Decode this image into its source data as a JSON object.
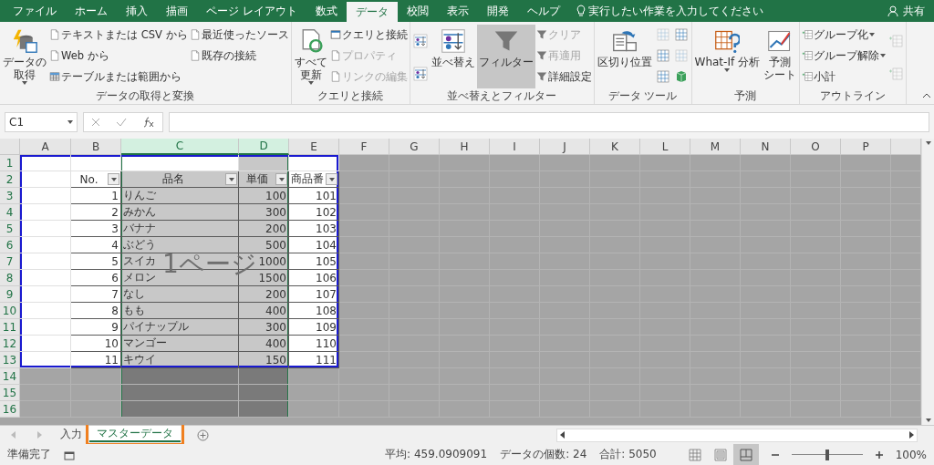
{
  "ribbon_tabs": [
    {
      "label": "ファイル",
      "selected": false
    },
    {
      "label": "ホーム",
      "selected": false
    },
    {
      "label": "挿入",
      "selected": false
    },
    {
      "label": "描画",
      "selected": false
    },
    {
      "label": "ページ レイアウト",
      "selected": false
    },
    {
      "label": "数式",
      "selected": false
    },
    {
      "label": "データ",
      "selected": true
    },
    {
      "label": "校閲",
      "selected": false
    },
    {
      "label": "表示",
      "selected": false
    },
    {
      "label": "開発",
      "selected": false
    },
    {
      "label": "ヘルプ",
      "selected": false
    }
  ],
  "tell_me": "実行したい作業を入力してください",
  "share": "共有",
  "ribbon_groups": [
    {
      "label": "データの取得と変換",
      "columns": [
        [
          {
            "kind": "large",
            "lines": [
              "データの",
              "取得"
            ],
            "dropdown": true,
            "disabled": false,
            "pressed": false
          }
        ],
        [
          {
            "kind": "small",
            "label": "テキストまたは CSV から",
            "disabled": false
          },
          {
            "kind": "small",
            "label": "Web から",
            "disabled": false
          },
          {
            "kind": "small",
            "label": "テーブルまたは範囲から",
            "disabled": false
          }
        ],
        [
          {
            "kind": "small",
            "label": "最近使ったソース",
            "disabled": false
          },
          {
            "kind": "small",
            "label": "既存の接続",
            "disabled": false
          }
        ]
      ]
    },
    {
      "label": "クエリと接続",
      "columns": [
        [
          {
            "kind": "large",
            "lines": [
              "すべて",
              "更新"
            ],
            "dropdown": true,
            "disabled": false,
            "pressed": false
          }
        ],
        [
          {
            "kind": "small",
            "label": "クエリと接続",
            "disabled": false
          },
          {
            "kind": "small",
            "label": "プロパティ",
            "disabled": true
          },
          {
            "kind": "small",
            "label": "リンクの編集",
            "disabled": true
          }
        ]
      ]
    },
    {
      "label": "並べ替えとフィルター",
      "columns": [
        [
          {
            "kind": "icon",
            "disabled": false
          },
          {
            "kind": "icon",
            "disabled": false
          }
        ],
        [
          {
            "kind": "large",
            "lines": [
              "並べ替え"
            ],
            "dropdown": false,
            "disabled": false,
            "pressed": false
          }
        ],
        [
          {
            "kind": "large",
            "lines": [
              "フィルター"
            ],
            "dropdown": false,
            "disabled": false,
            "pressed": true
          }
        ],
        [
          {
            "kind": "small",
            "label": "クリア",
            "disabled": true
          },
          {
            "kind": "small",
            "label": "再適用",
            "disabled": true
          },
          {
            "kind": "small",
            "label": "詳細設定",
            "disabled": false
          }
        ]
      ]
    },
    {
      "label": "データ ツール",
      "columns": [
        [
          {
            "kind": "large",
            "lines": [
              "区切り位置"
            ],
            "dropdown": false,
            "disabled": false,
            "pressed": false
          }
        ],
        [
          {
            "kind": "icon",
            "disabled": true
          },
          {
            "kind": "icon",
            "disabled": false
          },
          {
            "kind": "icon",
            "disabled": false
          }
        ],
        [
          {
            "kind": "icon",
            "disabled": false
          },
          {
            "kind": "icon",
            "disabled": true
          },
          {
            "kind": "icon",
            "disabled": false
          }
        ]
      ]
    },
    {
      "label": "予測",
      "columns": [
        [
          {
            "kind": "large",
            "lines": [
              "What-If 分析"
            ],
            "dropdown": true,
            "disabled": false,
            "pressed": false
          }
        ],
        [
          {
            "kind": "large",
            "lines": [
              "予測",
              "シート"
            ],
            "dropdown": false,
            "disabled": false,
            "pressed": false
          }
        ]
      ]
    },
    {
      "label": "アウトライン",
      "columns": [
        [
          {
            "kind": "small",
            "label": "グループ化",
            "disabled": false
          },
          {
            "kind": "small",
            "label": "グループ解除",
            "disabled": false
          },
          {
            "kind": "small",
            "label": "小計",
            "disabled": false
          }
        ],
        [
          {
            "kind": "icon",
            "disabled": true
          },
          {
            "kind": "icon",
            "disabled": true
          }
        ]
      ]
    }
  ],
  "name_box": "C1",
  "columns": [
    {
      "label": "A",
      "selected": false
    },
    {
      "label": "B",
      "selected": false
    },
    {
      "label": "C",
      "selected": true
    },
    {
      "label": "D",
      "selected": true
    },
    {
      "label": "E",
      "selected": false
    },
    {
      "label": "F",
      "selected": false
    },
    {
      "label": "G",
      "selected": false
    },
    {
      "label": "H",
      "selected": false
    },
    {
      "label": "I",
      "selected": false
    },
    {
      "label": "J",
      "selected": false
    },
    {
      "label": "K",
      "selected": false
    },
    {
      "label": "L",
      "selected": false
    },
    {
      "label": "M",
      "selected": false
    },
    {
      "label": "N",
      "selected": false
    },
    {
      "label": "O",
      "selected": false
    },
    {
      "label": "P",
      "selected": false
    }
  ],
  "rows": [
    "1",
    "2",
    "3",
    "4",
    "5",
    "6",
    "7",
    "8",
    "9",
    "10",
    "11",
    "12",
    "13",
    "14",
    "15",
    "16"
  ],
  "table": {
    "header": [
      "No.",
      "品名",
      "単価",
      "商品番"
    ],
    "rows": [
      [
        "1",
        "りんご",
        "100",
        "101"
      ],
      [
        "2",
        "みかん",
        "300",
        "102"
      ],
      [
        "3",
        "バナナ",
        "200",
        "103"
      ],
      [
        "4",
        "ぶどう",
        "500",
        "104"
      ],
      [
        "5",
        "スイカ",
        "1000",
        "105"
      ],
      [
        "6",
        "メロン",
        "1500",
        "106"
      ],
      [
        "7",
        "なし",
        "200",
        "107"
      ],
      [
        "8",
        "もも",
        "400",
        "108"
      ],
      [
        "9",
        "パイナップル",
        "300",
        "109"
      ],
      [
        "10",
        "マンゴー",
        "400",
        "110"
      ],
      [
        "11",
        "キウイ",
        "150",
        "111"
      ]
    ]
  },
  "page_label": "1ページ",
  "sheet_tabs": [
    {
      "label": "入力",
      "selected": false,
      "highlighted": false
    },
    {
      "label": "マスターデータ",
      "selected": true,
      "highlighted": true
    }
  ],
  "status": "準備完了",
  "stats": [
    "平均: 459.0909091",
    "データの個数: 24",
    "合計: 5050"
  ],
  "views": [
    {
      "selected": false
    },
    {
      "selected": false
    },
    {
      "selected": true
    }
  ],
  "zoom": {
    "level": 0.5,
    "reading": "100%"
  }
}
